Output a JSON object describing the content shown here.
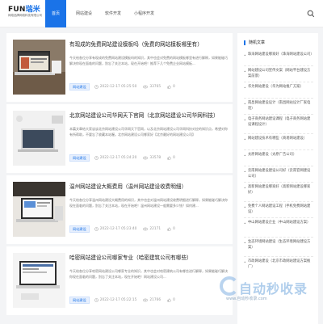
{
  "header": {
    "logo_main_a": "FUN",
    "logo_main_b": "瑞米",
    "logo_sub": "网络品牌网络科技有限公司",
    "nav": [
      "首页",
      "网站建设",
      "软件开发",
      "小程序开发"
    ]
  },
  "articles": [
    {
      "title": "有现成的免费网站建设模板吗（免费的网站模板哪里有）",
      "summary": "今天给各位分享有现成的免费网站建设模板吗的知识，其中也会对免费的网站模板哪里有进行解释，如果能碰巧解决你现在面临的问题，别忘了关注本站，现在开始吧！推荐下几个免费企业网站模板...",
      "tag": "网站建设",
      "date": "2022-12-17 05:25:50",
      "views": "33765",
      "likes": "0"
    },
    {
      "title": "北京网站建设公司华网天下官网（北京网站建设公司华网科技）",
      "summary": "本篇文章给大家谈谈北京网站建设公司华网天下官网，以及北京网站建设公司华网科技对应的知识点，希望对你有所帮助，不要忘了收藏本站喔。北京网站建设公司哪家好【北京最好的网站建设公司】",
      "tag": "网站建设",
      "date": "2022-12-17 05:24:20",
      "views": "33578",
      "likes": "0"
    },
    {
      "title": "温州网站建设大概费用（温州网站建设收费明细）",
      "summary": "今天给各位分享温州网站建设大概费用的知识，其中也会对温州网站建设收费明细进行解释，如果能碰巧解决你现在面临的问题，别忘了关注本站，现在开始吧！温州网站建设一般需要多少钱？如何建...",
      "tag": "网站建设",
      "date": "2022-12-17 05:23:40",
      "views": "22171",
      "likes": "0"
    },
    {
      "title": "哈密网站建设公司哪家专业（哈密建筑公司有哪些）",
      "summary": "今天给各位分享哈密网站建设公司哪家专业的知识，其中也会对哈密建筑公司有哪些进行解释，如果能碰巧解决你现在面临的问题，别忘了关注本站，现在开始吧！网站建设公司...",
      "tag": "网站建设",
      "date": "2022-12-17 05:22:15",
      "views": "21766",
      "likes": "0"
    }
  ],
  "sidebar": {
    "title": "随机文章",
    "items": [
      "珠海网站建设哪家好（珠海网站建设公司）",
      "网站建设公司宣传文案（网站平台建设方案前景）",
      "华为网站建设（华为网站推广方案）",
      "南昌网站建设设计（南昌网站设计厂家电话）",
      "电子商务网站建设课程（电子商务网站建设课程设计）",
      "网站建设技术有哪些（商易网站建设）",
      "太原网站建设（太原广告公司）",
      "云南网站建设建设公司好（云南官网建设公司）",
      "高新网站建设哪家好（高新网站建设哪家好）",
      "免费个人网站建设工程（手机免费网站建设）",
      "中山网站建设企业（中山网站建设方案）",
      "生态环境网站建设（生态环境网站建设方案）",
      "市政网站建设（北京市政网站建设方案推广）"
    ]
  },
  "watermark": {
    "main": "自动秒收录",
    "sub": "www.自动秒收录.com"
  }
}
